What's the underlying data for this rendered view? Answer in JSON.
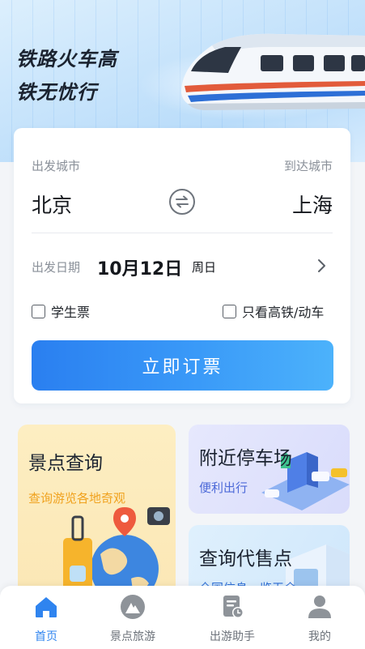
{
  "banner": {
    "slogan_line1": "铁路火车高",
    "slogan_line2": "铁无忧行"
  },
  "booking": {
    "from_label": "出发城市",
    "to_label": "到达城市",
    "from_city": "北京",
    "to_city": "上海",
    "date_label": "出发日期",
    "date_value": "10月12日",
    "weekday": "周日",
    "student_ticket_label": "学生票",
    "high_speed_only_label": "只看高铁/动车",
    "book_button": "立即订票"
  },
  "features": {
    "attractions_title": "景点查询",
    "attractions_sub": "查询游览各地奇观",
    "parking_title": "附近停车场",
    "parking_sub": "便利出行",
    "agency_title": "查询代售点",
    "agency_sub": "全国信息一览无余"
  },
  "tabs": [
    {
      "label": "首页",
      "icon": "home-icon",
      "active": true
    },
    {
      "label": "景点旅游",
      "icon": "mountain-icon",
      "active": false
    },
    {
      "label": "出游助手",
      "icon": "document-clock-icon",
      "active": false
    },
    {
      "label": "我的",
      "icon": "profile-icon",
      "active": false
    }
  ],
  "colors": {
    "accent": "#2f84ef",
    "button_gradient_start": "#2a7ff0",
    "button_gradient_end": "#4cb2fb",
    "attractions_tile": "#fdeec2",
    "parking_tile": "#e6e8fd",
    "agency_tile": "#dff0fd"
  }
}
